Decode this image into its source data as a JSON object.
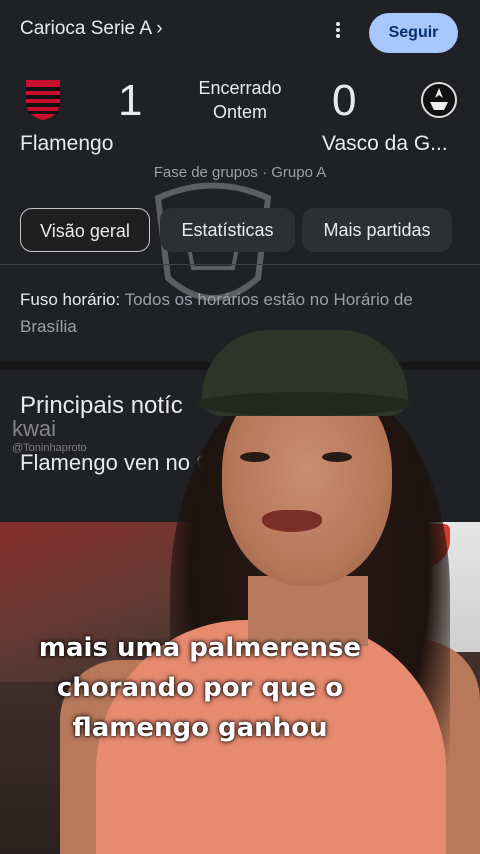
{
  "header": {
    "league_label": "Carioca Serie A ›",
    "follow_label": "Seguir"
  },
  "match": {
    "home_team": "Flamengo",
    "away_team": "Vasco da G...",
    "home_score": "1",
    "away_score": "0",
    "status_line1": "Encerrado",
    "status_line2": "Ontem",
    "stage": "Fase de grupos · Grupo A"
  },
  "tabs": [
    {
      "label": "Visão geral",
      "active": true
    },
    {
      "label": "Estatísticas",
      "active": false
    },
    {
      "label": "Mais partidas",
      "active": false
    }
  ],
  "timezone": {
    "label": "Fuso horário:",
    "value": "Todos os horários estão no Horário de Brasília"
  },
  "news": {
    "section_title": "Principais notíc",
    "headline": "Flamengo ven                       no Campeonato C"
  },
  "overlay": {
    "watermark": "kwai",
    "watermark_user": "@Toninhaproto",
    "caption_line1": "mais uma palmerense",
    "caption_line2": "chorando por que o",
    "caption_line3": "flamengo ganhou"
  },
  "colors": {
    "background": "#202124",
    "follow_button": "#a8c7fa",
    "tank_top": "#e68a70"
  }
}
